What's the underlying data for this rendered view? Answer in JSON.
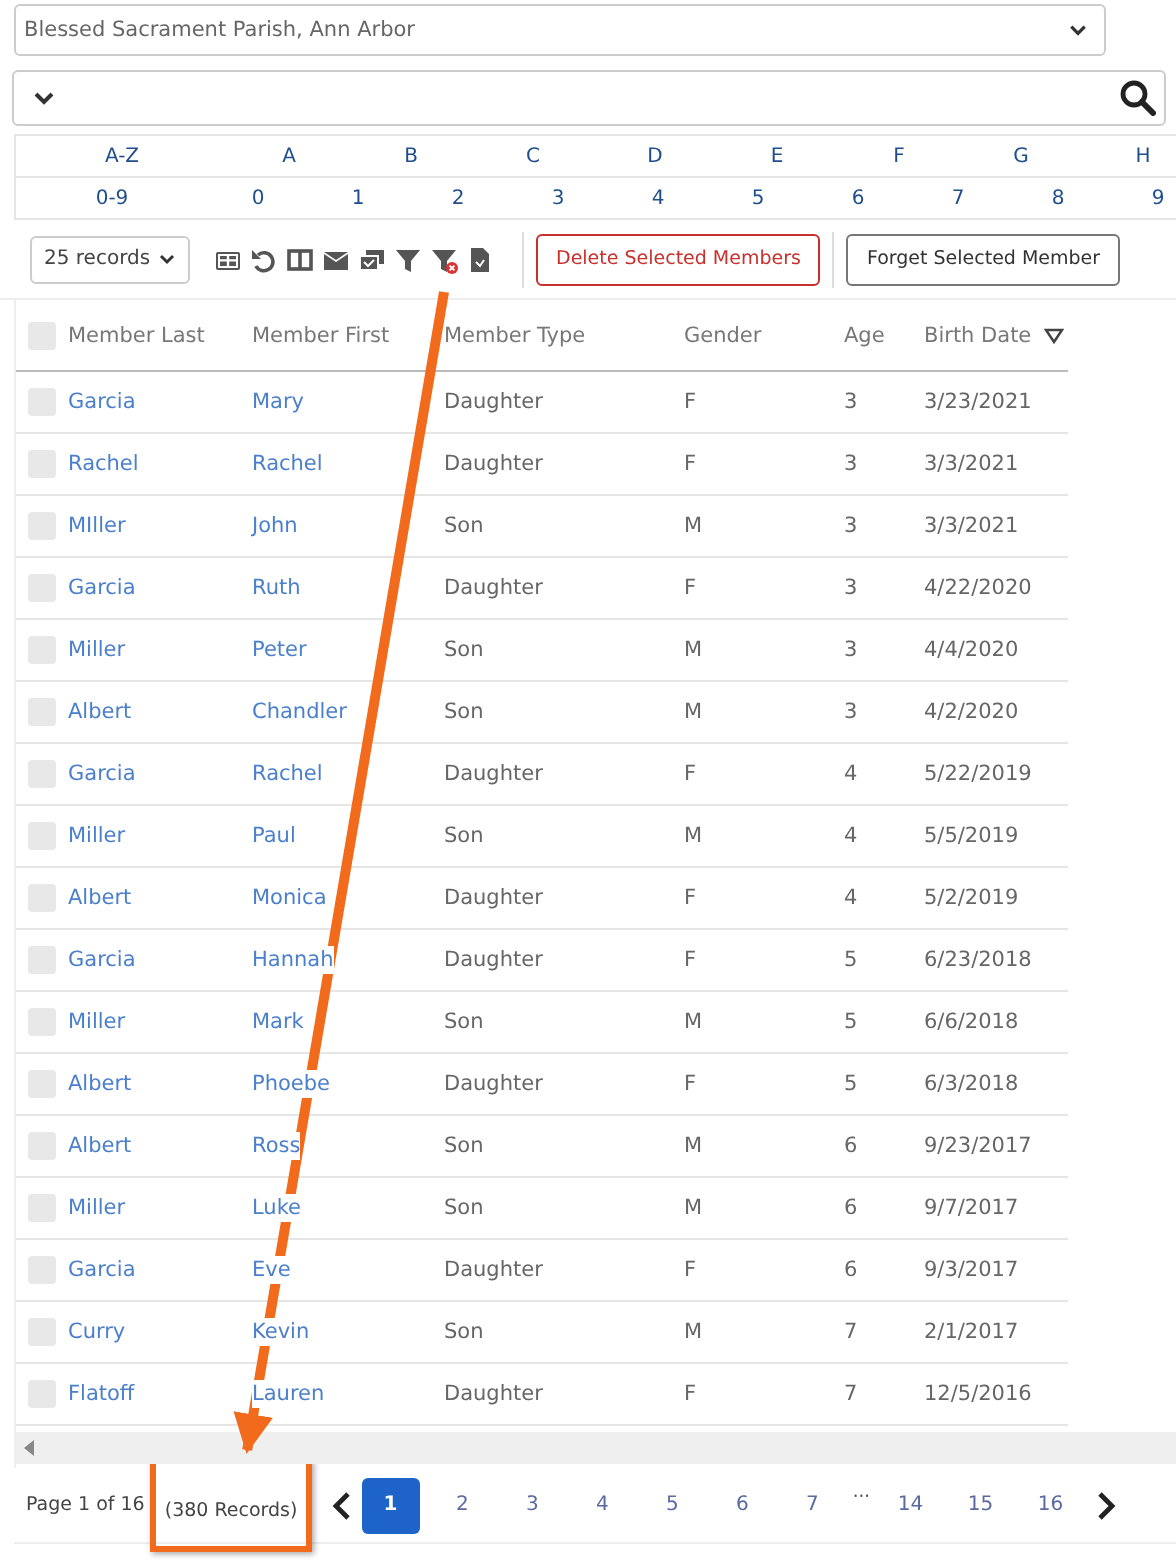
{
  "parish_select": {
    "value": "Blessed Sacrament Parish, Ann Arbor"
  },
  "letter_filter": [
    "A-Z",
    "A",
    "B",
    "C",
    "D",
    "E",
    "F",
    "G",
    "H"
  ],
  "digit_filter": [
    "0-9",
    "0",
    "1",
    "2",
    "3",
    "4",
    "5",
    "6",
    "7",
    "8",
    "9"
  ],
  "toolbar": {
    "page_size": "25 records",
    "buttons": [
      {
        "label": "Delete Selected Members",
        "kind": "danger"
      },
      {
        "label": "Forget Selected Member",
        "kind": "plain"
      }
    ]
  },
  "table": {
    "columns": [
      {
        "label": "Member Last",
        "sorted_desc": false
      },
      {
        "label": "Member First",
        "sorted_desc": false
      },
      {
        "label": "Member Type",
        "sorted_desc": false
      },
      {
        "label": "Gender",
        "sorted_desc": false
      },
      {
        "label": "Age",
        "sorted_desc": false
      },
      {
        "label": "Birth Date",
        "sorted_desc": true
      }
    ],
    "header_checked": false,
    "rows": [
      {
        "checked": false,
        "cells": [
          "Garcia",
          "Mary",
          "Daughter",
          "F",
          "3",
          "3/23/2021"
        ]
      },
      {
        "checked": false,
        "cells": [
          "Rachel",
          "Rachel",
          "Daughter",
          "F",
          "3",
          "3/3/2021"
        ]
      },
      {
        "checked": false,
        "cells": [
          "MIller",
          "John",
          "Son",
          "M",
          "3",
          "3/3/2021"
        ]
      },
      {
        "checked": false,
        "cells": [
          "Garcia",
          "Ruth",
          "Daughter",
          "F",
          "3",
          "4/22/2020"
        ]
      },
      {
        "checked": false,
        "cells": [
          "Miller",
          "Peter",
          "Son",
          "M",
          "3",
          "4/4/2020"
        ]
      },
      {
        "checked": false,
        "cells": [
          "Albert",
          "Chandler",
          "Son",
          "M",
          "3",
          "4/2/2020"
        ]
      },
      {
        "checked": false,
        "cells": [
          "Garcia",
          "Rachel",
          "Daughter",
          "F",
          "4",
          "5/22/2019"
        ]
      },
      {
        "checked": false,
        "cells": [
          "Miller",
          "Paul",
          "Son",
          "M",
          "4",
          "5/5/2019"
        ]
      },
      {
        "checked": false,
        "cells": [
          "Albert",
          "Monica",
          "Daughter",
          "F",
          "4",
          "5/2/2019"
        ]
      },
      {
        "checked": false,
        "cells": [
          "Garcia",
          "Hannah",
          "Daughter",
          "F",
          "5",
          "6/23/2018"
        ]
      },
      {
        "checked": false,
        "cells": [
          "Miller",
          "Mark",
          "Son",
          "M",
          "5",
          "6/6/2018"
        ]
      },
      {
        "checked": false,
        "cells": [
          "Albert",
          "Phoebe",
          "Daughter",
          "F",
          "5",
          "6/3/2018"
        ]
      },
      {
        "checked": false,
        "cells": [
          "Albert",
          "Ross",
          "Son",
          "M",
          "6",
          "9/23/2017"
        ]
      },
      {
        "checked": false,
        "cells": [
          "Miller",
          "Luke",
          "Son",
          "M",
          "6",
          "9/7/2017"
        ]
      },
      {
        "checked": false,
        "cells": [
          "Garcia",
          "Eve",
          "Daughter",
          "F",
          "6",
          "9/3/2017"
        ]
      },
      {
        "checked": false,
        "cells": [
          "Curry",
          "Kevin",
          "Son",
          "M",
          "7",
          "2/1/2017"
        ]
      },
      {
        "checked": false,
        "cells": [
          "Flatoff",
          "Lauren",
          "Daughter",
          "F",
          "7",
          "12/5/2016"
        ]
      }
    ]
  },
  "pagination": {
    "summary": "Page 1 of 16",
    "record_count": "(380 Records)",
    "pages": [
      {
        "label": "1",
        "kind": "page",
        "selected": true
      },
      {
        "label": "2",
        "kind": "page",
        "selected": false
      },
      {
        "label": "3",
        "kind": "page",
        "selected": false
      },
      {
        "label": "4",
        "kind": "page",
        "selected": false
      },
      {
        "label": "5",
        "kind": "page",
        "selected": false
      },
      {
        "label": "6",
        "kind": "page",
        "selected": false
      },
      {
        "label": "7",
        "kind": "page",
        "selected": false
      },
      {
        "label": "···",
        "kind": "gap"
      },
      {
        "label": "14",
        "kind": "page",
        "selected": false
      },
      {
        "label": "15",
        "kind": "page",
        "selected": false
      },
      {
        "label": "16",
        "kind": "page",
        "selected": false
      }
    ]
  }
}
